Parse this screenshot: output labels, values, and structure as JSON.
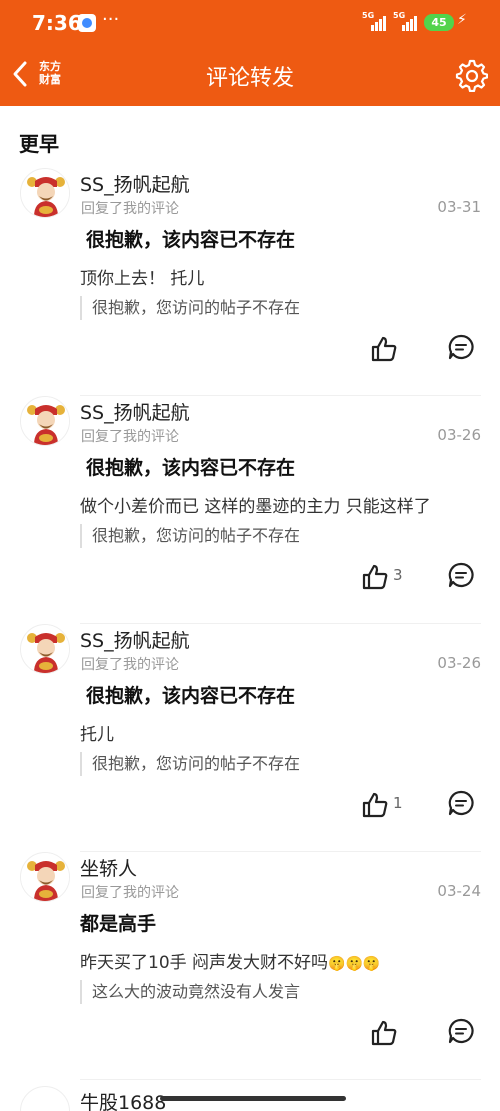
{
  "status_bar": {
    "time": "7:36",
    "more": "···",
    "net1": "5G",
    "net2": "5G",
    "battery": "45"
  },
  "nav": {
    "back_label": "‹",
    "logo_line1": "东方",
    "logo_line2": "财富",
    "title": "评论转发"
  },
  "section_title": "更早",
  "comments": [
    {
      "name": "SS_扬帆起航",
      "subtitle": "回复了我的评论",
      "date": "03-31",
      "title": "很抱歉，该内容已不存在",
      "content": "顶你上去！ 托儿",
      "quote": "很抱歉，您访问的帖子不存在",
      "likes": ""
    },
    {
      "name": "SS_扬帆起航",
      "subtitle": "回复了我的评论",
      "date": "03-26",
      "title": "很抱歉，该内容已不存在",
      "content": "做个小差价而已  这样的墨迹的主力 只能这样了",
      "quote": "很抱歉，您访问的帖子不存在",
      "likes": "3"
    },
    {
      "name": "SS_扬帆起航",
      "subtitle": "回复了我的评论",
      "date": "03-26",
      "title": "很抱歉，该内容已不存在",
      "content": "托儿",
      "quote": "很抱歉，您访问的帖子不存在",
      "likes": "1"
    },
    {
      "name": "坐轿人",
      "subtitle": "回复了我的评论",
      "date": "03-24",
      "title": "都是高手",
      "content": "昨天买了10手 闷声发大财不好吗",
      "emoji": "🤫🤫🤫",
      "quote": "这么大的波动竟然没有人发言",
      "likes": ""
    }
  ],
  "partial_comment": {
    "name": "牛股1688"
  },
  "colors": {
    "brand": "#ee5a12",
    "muted": "#999999"
  }
}
